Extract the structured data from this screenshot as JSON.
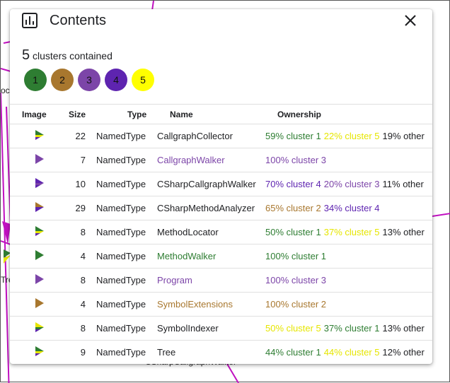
{
  "background": {
    "labels": [
      {
        "text": "oca"
      },
      {
        "text": "Tre"
      },
      {
        "text": "CSharpCallgraphWalker"
      }
    ]
  },
  "dialog": {
    "title": "Contents",
    "icon": "bar-chart-icon",
    "close_icon": "close-icon",
    "cluster_count": "5",
    "cluster_count_label": "clusters contained",
    "clusters": [
      {
        "label": "1",
        "color": "#2e7d32"
      },
      {
        "label": "2",
        "color": "#a8772e"
      },
      {
        "label": "3",
        "color": "#7c45a8"
      },
      {
        "label": "4",
        "color": "#5e24b0"
      },
      {
        "label": "5",
        "color": "#ffff00"
      }
    ]
  },
  "table": {
    "headers": {
      "image": "Image",
      "size": "Size",
      "type": "Type",
      "name": "Name",
      "ownership": "Ownership"
    },
    "rows": [
      {
        "icon": "multi-cluster-triangle-icon",
        "size": "22",
        "type": "NamedType",
        "name": "CallgraphCollector",
        "name_color": "#202124",
        "ownership": [
          {
            "text": "59% cluster 1",
            "color": "#2e7d32"
          },
          {
            "text": "22% cluster 5",
            "color": "#e6e600"
          },
          {
            "text": "19% other",
            "color": "#202124"
          }
        ]
      },
      {
        "icon": "cluster-3-triangle-icon",
        "size": "7",
        "type": "NamedType",
        "name": "CallgraphWalker",
        "name_color": "#7c45a8",
        "ownership": [
          {
            "text": "100% cluster 3",
            "color": "#7c45a8"
          }
        ]
      },
      {
        "icon": "multi-cluster-triangle-icon",
        "size": "10",
        "type": "NamedType",
        "name": "CSharpCallgraphWalker",
        "name_color": "#202124",
        "ownership": [
          {
            "text": "70% cluster 4",
            "color": "#5e24b0"
          },
          {
            "text": "20% cluster 3",
            "color": "#7c45a8"
          },
          {
            "text": "11% other",
            "color": "#202124"
          }
        ]
      },
      {
        "icon": "multi-cluster-triangle-icon",
        "size": "29",
        "type": "NamedType",
        "name": "CSharpMethodAnalyzer",
        "name_color": "#202124",
        "ownership": [
          {
            "text": "65% cluster 2",
            "color": "#a8772e"
          },
          {
            "text": "34% cluster 4",
            "color": "#5e24b0"
          }
        ]
      },
      {
        "icon": "multi-cluster-triangle-icon",
        "size": "8",
        "type": "NamedType",
        "name": "MethodLocator",
        "name_color": "#202124",
        "ownership": [
          {
            "text": "50% cluster 1",
            "color": "#2e7d32"
          },
          {
            "text": "37% cluster 5",
            "color": "#e6e600"
          },
          {
            "text": "13% other",
            "color": "#202124"
          }
        ]
      },
      {
        "icon": "cluster-1-triangle-icon",
        "size": "4",
        "type": "NamedType",
        "name": "MethodWalker",
        "name_color": "#2e7d32",
        "ownership": [
          {
            "text": "100% cluster 1",
            "color": "#2e7d32"
          }
        ]
      },
      {
        "icon": "cluster-3-triangle-icon",
        "size": "8",
        "type": "NamedType",
        "name": "Program",
        "name_color": "#7c45a8",
        "ownership": [
          {
            "text": "100% cluster 3",
            "color": "#7c45a8"
          }
        ]
      },
      {
        "icon": "cluster-2-triangle-icon",
        "size": "4",
        "type": "NamedType",
        "name": "SymbolExtensions",
        "name_color": "#a8772e",
        "ownership": [
          {
            "text": "100% cluster 2",
            "color": "#a8772e"
          }
        ]
      },
      {
        "icon": "multi-cluster-triangle-icon",
        "size": "8",
        "type": "NamedType",
        "name": "SymbolIndexer",
        "name_color": "#202124",
        "ownership": [
          {
            "text": "50% cluster 5",
            "color": "#e6e600"
          },
          {
            "text": "37% cluster 1",
            "color": "#2e7d32"
          },
          {
            "text": "13% other",
            "color": "#202124"
          }
        ]
      },
      {
        "icon": "multi-cluster-triangle-icon",
        "size": "9",
        "type": "NamedType",
        "name": "Tree",
        "name_color": "#202124",
        "ownership": [
          {
            "text": "44% cluster 1",
            "color": "#2e7d32"
          },
          {
            "text": "44% cluster 5",
            "color": "#e6e600"
          },
          {
            "text": "12% other",
            "color": "#202124"
          }
        ]
      }
    ]
  }
}
